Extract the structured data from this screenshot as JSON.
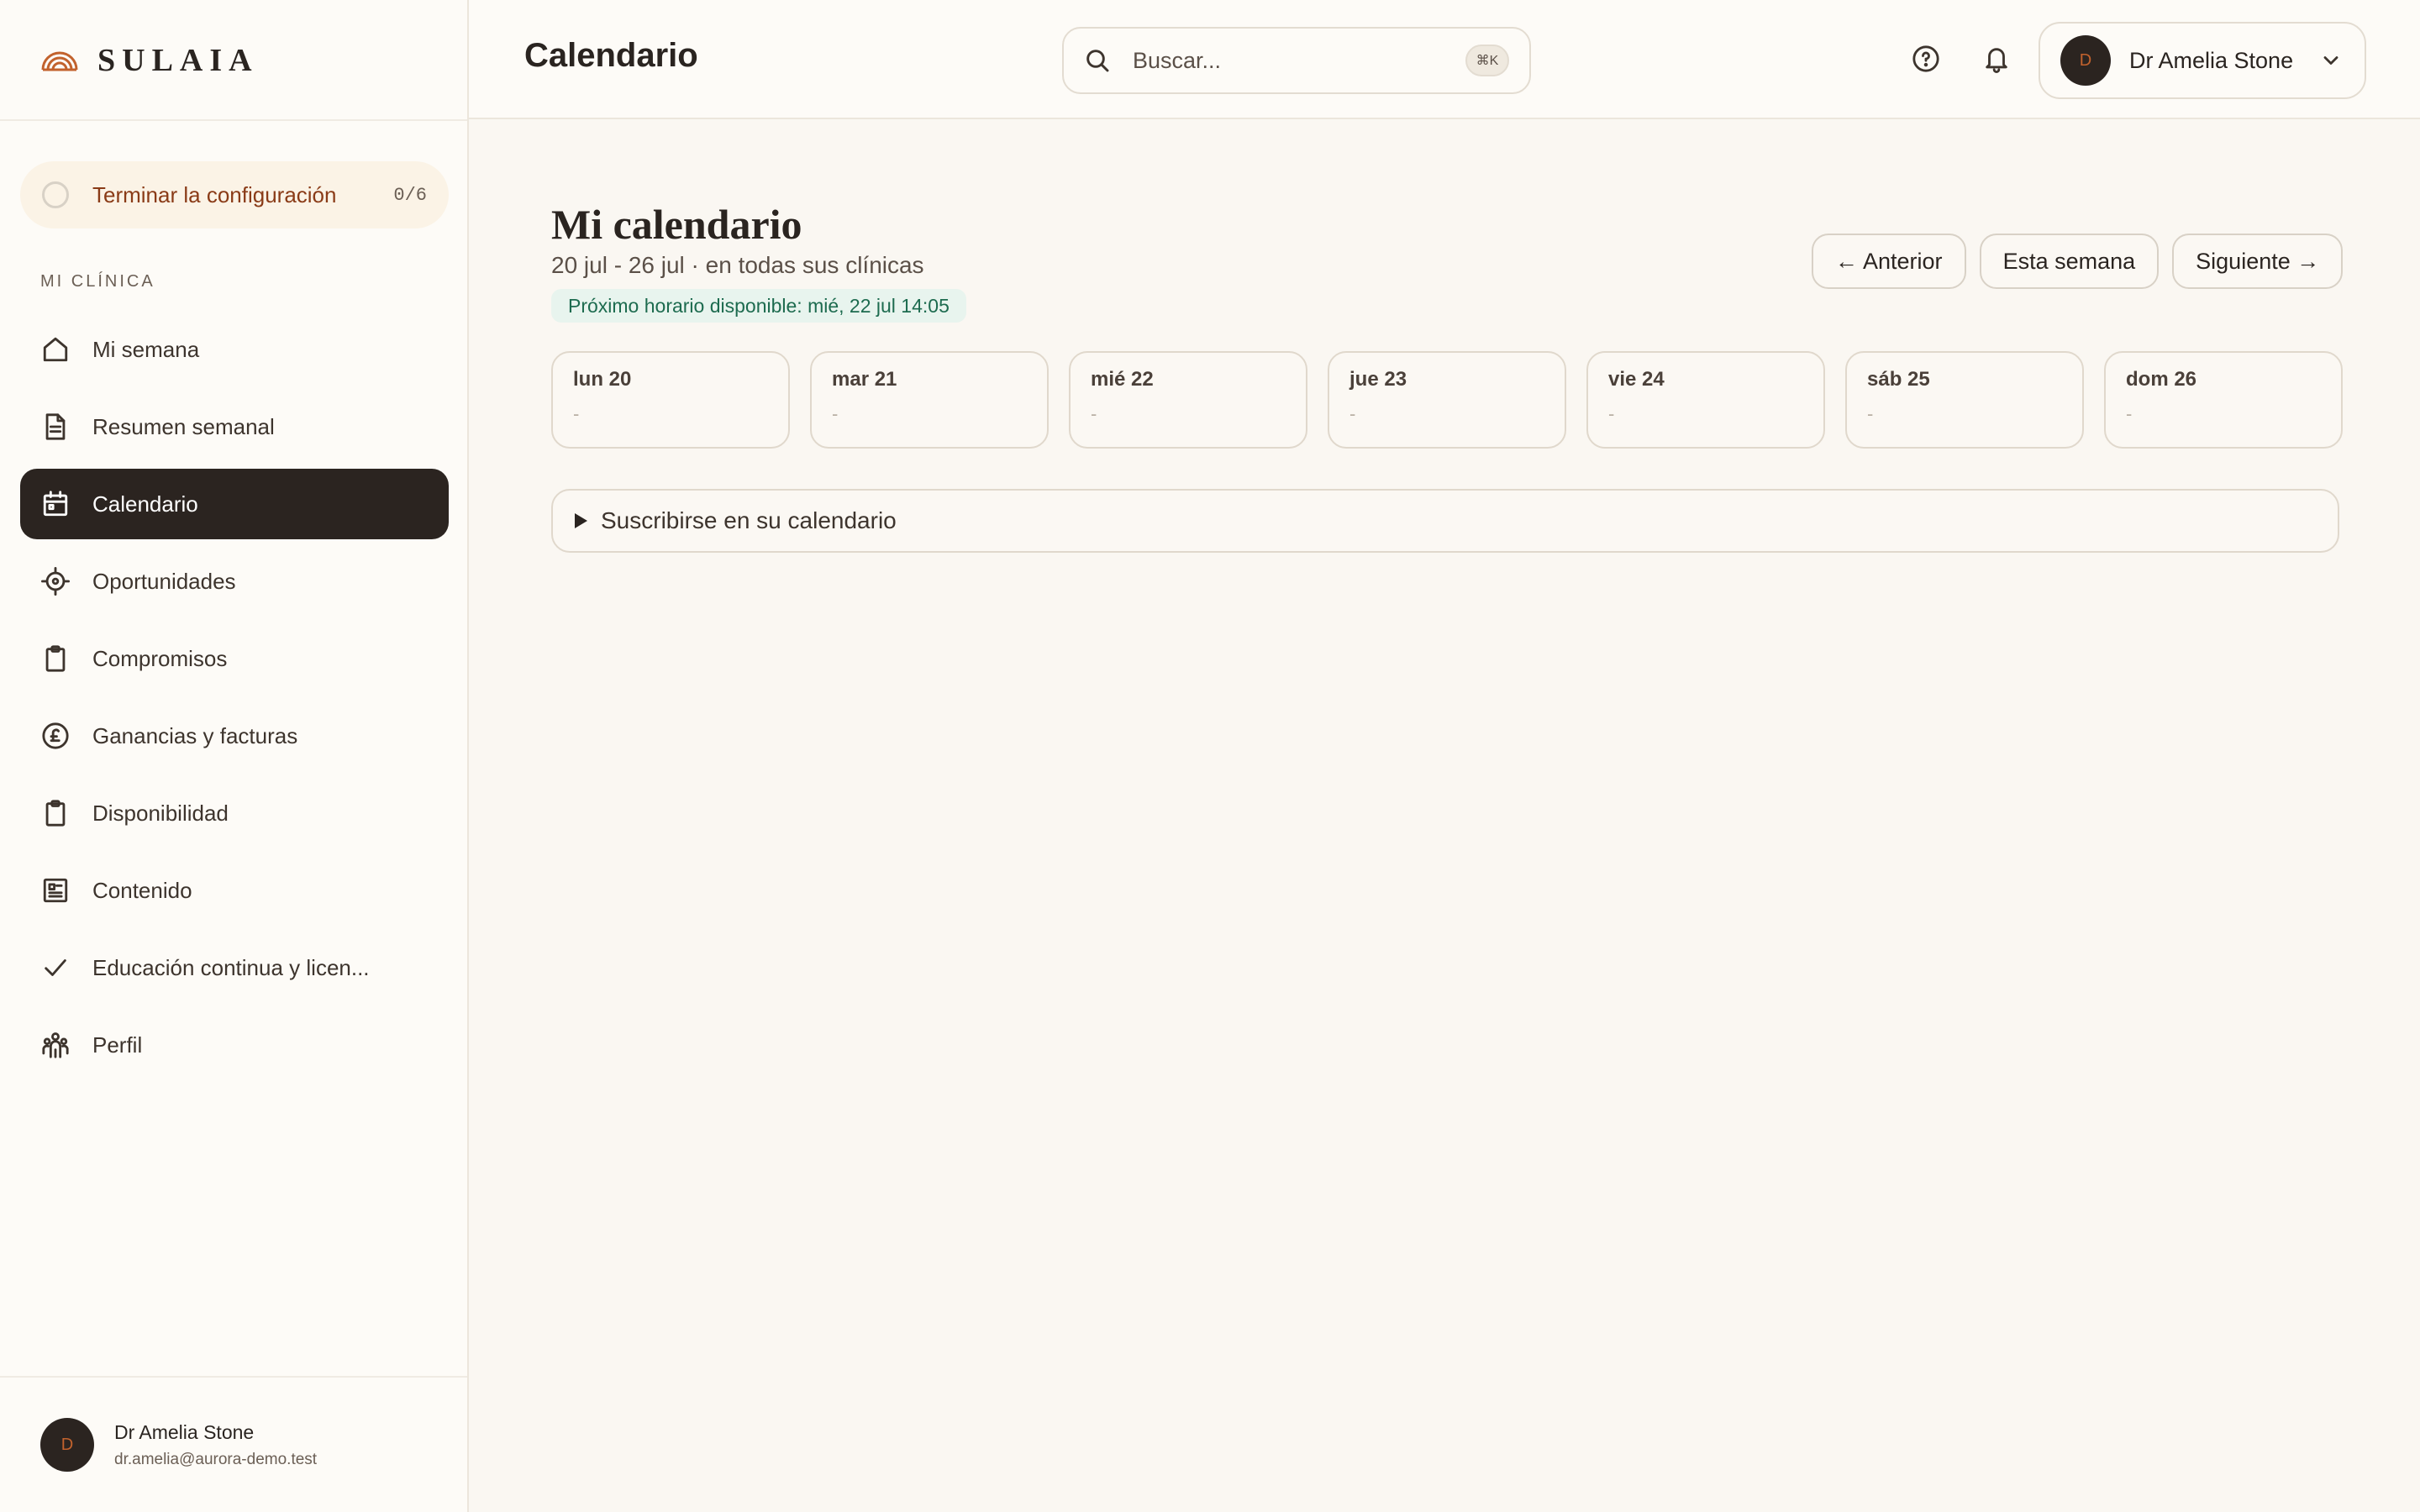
{
  "brand": {
    "name": "SULAIA"
  },
  "sidebar": {
    "setup": {
      "label": "Terminar la configuración",
      "count": "0/6"
    },
    "section_label": "MI CLÍNICA",
    "items": [
      {
        "label": "Mi semana",
        "icon": "home-icon",
        "active": false
      },
      {
        "label": "Resumen semanal",
        "icon": "document-icon",
        "active": false
      },
      {
        "label": "Calendario",
        "icon": "calendar-icon",
        "active": true
      },
      {
        "label": "Oportunidades",
        "icon": "crosshair-icon",
        "active": false
      },
      {
        "label": "Compromisos",
        "icon": "clipboard-icon",
        "active": false
      },
      {
        "label": "Ganancias y facturas",
        "icon": "pound-icon",
        "active": false
      },
      {
        "label": "Disponibilidad",
        "icon": "clipboard-icon",
        "active": false
      },
      {
        "label": "Contenido",
        "icon": "newspaper-icon",
        "active": false
      },
      {
        "label": "Educación continua y licen...",
        "icon": "check-icon",
        "active": false
      },
      {
        "label": "Perfil",
        "icon": "people-icon",
        "active": false
      }
    ],
    "user": {
      "initial": "D",
      "name": "Dr Amelia Stone",
      "email": "dr.amelia@aurora-demo.test"
    }
  },
  "topbar": {
    "title": "Calendario",
    "search": {
      "placeholder": "Buscar...",
      "shortcut": "⌘K"
    },
    "profile": {
      "initial": "D",
      "name": "Dr Amelia Stone"
    }
  },
  "main": {
    "title": "Mi calendario",
    "subtitle": "20 jul - 26 jul · en todas sus clínicas",
    "next_slot": "Próximo horario disponible: mié, 22 jul 14:05",
    "nav": {
      "prev": "← Anterior",
      "current": "Esta semana",
      "next": "Siguiente →"
    },
    "days": [
      {
        "label": "lun 20",
        "value": "-"
      },
      {
        "label": "mar 21",
        "value": "-"
      },
      {
        "label": "mié 22",
        "value": "-"
      },
      {
        "label": "jue 23",
        "value": "-"
      },
      {
        "label": "vie 24",
        "value": "-"
      },
      {
        "label": "sáb 25",
        "value": "-"
      },
      {
        "label": "dom 26",
        "value": "-"
      }
    ],
    "subscribe": "Suscribirse en su calendario"
  },
  "colors": {
    "accent_dark": "#2b2420",
    "setup_text": "#8a3b17",
    "success_bg": "#e8f4ee",
    "success_text": "#1d6b4f",
    "background": "#faf7f2"
  }
}
